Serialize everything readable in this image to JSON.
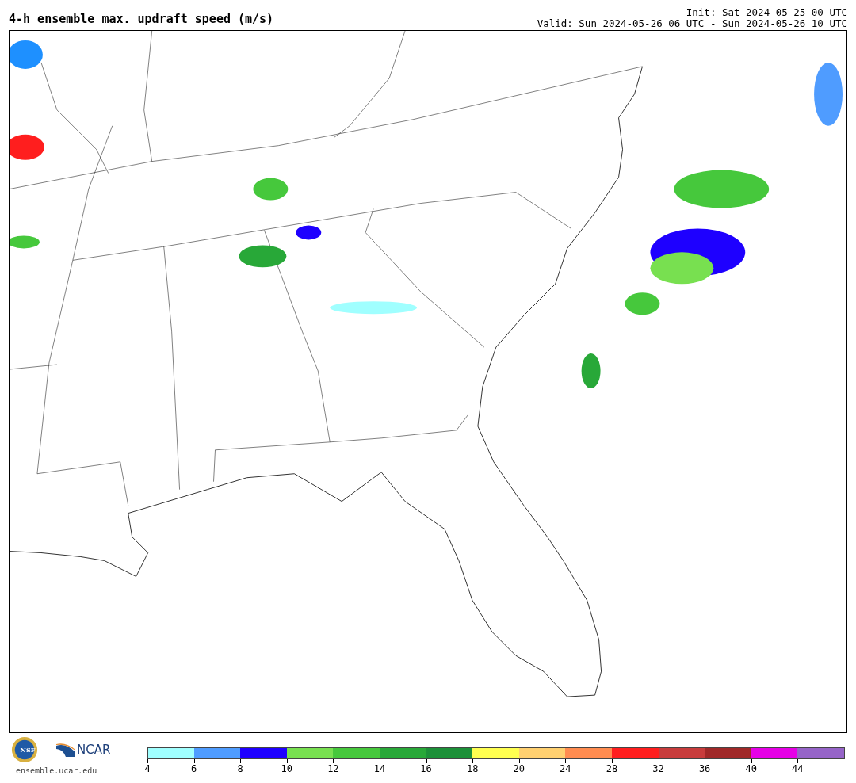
{
  "title": "4-h ensemble max. updraft speed (m/s)",
  "init": "Init: Sat 2024-05-25 00 UTC",
  "valid": "Valid: Sun 2024-05-26 06 UTC - Sun 2024-05-26 10 UTC",
  "logos": {
    "nsf": "NSF",
    "ncar": "NCAR",
    "url": "ensemble.ucar.edu"
  },
  "colorbar": [
    {
      "label": "4",
      "color": "#a0ffff"
    },
    {
      "label": "6",
      "color": "#4f9cff"
    },
    {
      "label": "8",
      "color": "#1e00ff"
    },
    {
      "label": "10",
      "color": "#78e050"
    },
    {
      "label": "12",
      "color": "#46c83c"
    },
    {
      "label": "14",
      "color": "#28a838"
    },
    {
      "label": "16",
      "color": "#1c9038"
    },
    {
      "label": "18",
      "color": "#ffff50"
    },
    {
      "label": "20",
      "color": "#ffd070"
    },
    {
      "label": "24",
      "color": "#ff8c50"
    },
    {
      "label": "28",
      "color": "#ff1e1e"
    },
    {
      "label": "32",
      "color": "#c83c3c"
    },
    {
      "label": "36",
      "color": "#a02828"
    },
    {
      "label": "40",
      "color": "#e600e6"
    },
    {
      "label": "44",
      "color": "#9664c8"
    }
  ]
}
